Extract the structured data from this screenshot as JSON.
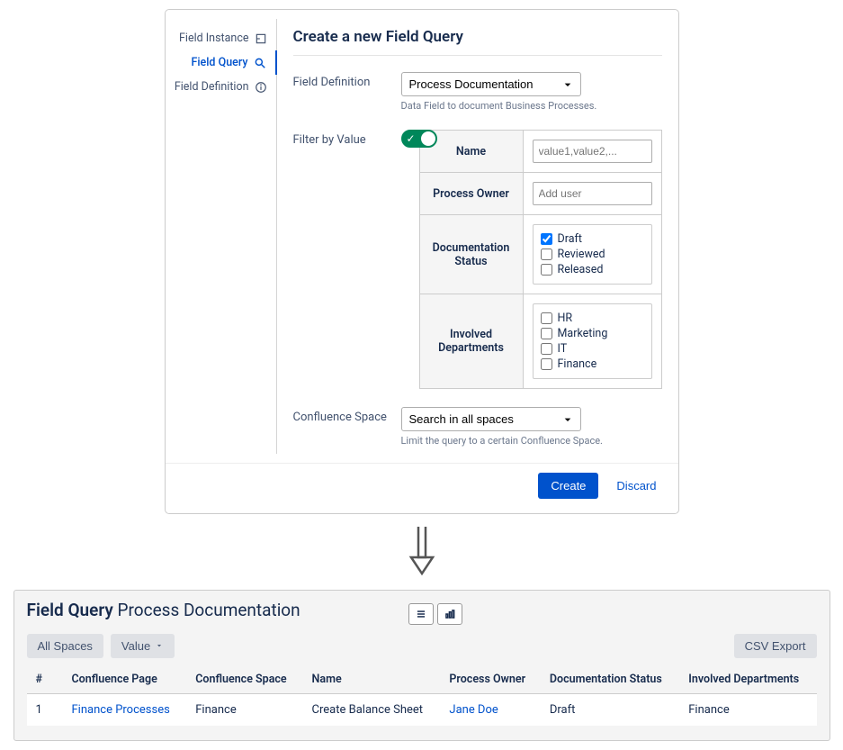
{
  "sidebar": {
    "items": [
      {
        "label": "Field Instance"
      },
      {
        "label": "Field Query"
      },
      {
        "label": "Field Definition"
      }
    ]
  },
  "form": {
    "title": "Create a new Field Query",
    "field_definition": {
      "label": "Field Definition",
      "selected": "Process Documentation",
      "hint": "Data Field to document Business Processes."
    },
    "filter_by_value": {
      "label": "Filter by Value",
      "rows": {
        "name": {
          "label": "Name",
          "placeholder": "value1,value2,..."
        },
        "process_owner": {
          "label": "Process Owner",
          "placeholder": "Add user"
        },
        "documentation_status": {
          "label": "Documentation Status",
          "options": [
            {
              "label": "Draft",
              "checked": true
            },
            {
              "label": "Reviewed",
              "checked": false
            },
            {
              "label": "Released",
              "checked": false
            }
          ]
        },
        "involved_departments": {
          "label": "Involved Departments",
          "options": [
            {
              "label": "HR",
              "checked": false
            },
            {
              "label": "Marketing",
              "checked": false
            },
            {
              "label": "IT",
              "checked": false
            },
            {
              "label": "Finance",
              "checked": false
            }
          ]
        }
      }
    },
    "confluence_space": {
      "label": "Confluence Space",
      "selected": "Search in all spaces",
      "hint": "Limit the query to a certain Confluence Space."
    },
    "actions": {
      "create": "Create",
      "discard": "Discard"
    }
  },
  "results": {
    "title_bold": "Field Query",
    "title_rest": "Process Documentation",
    "filters": {
      "all_spaces": "All Spaces",
      "value": "Value"
    },
    "csv_export": "CSV Export",
    "columns": [
      "#",
      "Confluence Page",
      "Confluence Space",
      "Name",
      "Process Owner",
      "Documentation Status",
      "Involved Departments"
    ],
    "rows": [
      {
        "num": "1",
        "page": "Finance Processes",
        "space": "Finance",
        "name": "Create Balance Sheet",
        "owner": "Jane Doe",
        "status": "Draft",
        "depts": "Finance"
      }
    ]
  }
}
